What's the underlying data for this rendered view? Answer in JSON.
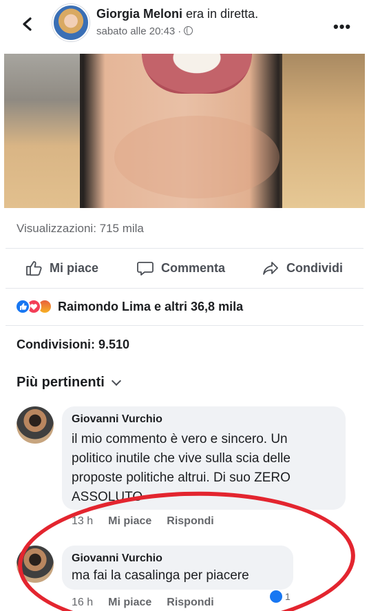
{
  "header": {
    "page_name": "Giorgia Meloni",
    "status_text": "era in diretta.",
    "timestamp": "sabato alle 20:43",
    "privacy_icon": "globe-icon",
    "more_icon": "more-icon",
    "back_icon": "chevron-left-icon"
  },
  "post": {
    "views_text": "Visualizzazioni: 715 mila",
    "actions": [
      {
        "label": "Mi piace",
        "icon": "thumbs-up-icon"
      },
      {
        "label": "Commenta",
        "icon": "comment-icon"
      },
      {
        "label": "Condividi",
        "icon": "share-icon"
      }
    ],
    "reactions_text": "Raimondo Lima e altri 36,8 mila",
    "shares_text": "Condivisioni: 9.510",
    "sort_label": "Più pertinenti"
  },
  "comments": [
    {
      "author": "Giovanni Vurchio",
      "text_lines": [
        "il mio commento è vero e sincero. Un",
        "politico inutile che vive sulla scia delle",
        "proposte politiche altrui. Di suo ZERO",
        "ASSOLUTO"
      ],
      "time": "13 h",
      "like_label": "Mi piace",
      "reply_label": "Rispondi"
    },
    {
      "author": "Giovanni Vurchio",
      "text_lines": [
        "ma fai la casalinga per piacere"
      ],
      "time": "16 h",
      "like_label": "Mi piace",
      "reply_label": "Rispondi",
      "like_count": "1"
    }
  ],
  "colors": {
    "accent": "#1877f2",
    "highlight_ring": "#e3252f",
    "bubble": "#f0f2f5"
  }
}
